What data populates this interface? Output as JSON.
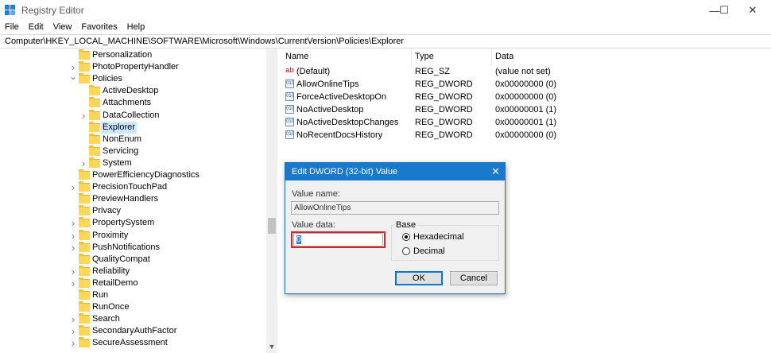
{
  "window": {
    "title": "Registry Editor"
  },
  "menu": [
    "File",
    "Edit",
    "View",
    "Favorites",
    "Help"
  ],
  "address": "Computer\\HKEY_LOCAL_MACHINE\\SOFTWARE\\Microsoft\\Windows\\CurrentVersion\\Policies\\Explorer",
  "tree": [
    {
      "label": "Personalization",
      "level": 0,
      "chevron": ""
    },
    {
      "label": "PhotoPropertyHandler",
      "level": 0,
      "chevron": ">"
    },
    {
      "label": "Policies",
      "level": 0,
      "chevron": "v"
    },
    {
      "label": "ActiveDesktop",
      "level": 1,
      "chevron": ""
    },
    {
      "label": "Attachments",
      "level": 1,
      "chevron": ""
    },
    {
      "label": "DataCollection",
      "level": 1,
      "chevron": ">"
    },
    {
      "label": "Explorer",
      "level": 1,
      "chevron": "",
      "selected": true
    },
    {
      "label": "NonEnum",
      "level": 1,
      "chevron": ""
    },
    {
      "label": "Servicing",
      "level": 1,
      "chevron": ""
    },
    {
      "label": "System",
      "level": 1,
      "chevron": ">"
    },
    {
      "label": "PowerEfficiencyDiagnostics",
      "level": 0,
      "chevron": ""
    },
    {
      "label": "PrecisionTouchPad",
      "level": 0,
      "chevron": ">"
    },
    {
      "label": "PreviewHandlers",
      "level": 0,
      "chevron": ""
    },
    {
      "label": "Privacy",
      "level": 0,
      "chevron": ""
    },
    {
      "label": "PropertySystem",
      "level": 0,
      "chevron": ">"
    },
    {
      "label": "Proximity",
      "level": 0,
      "chevron": ">"
    },
    {
      "label": "PushNotifications",
      "level": 0,
      "chevron": ">"
    },
    {
      "label": "QualityCompat",
      "level": 0,
      "chevron": ""
    },
    {
      "label": "Reliability",
      "level": 0,
      "chevron": ">"
    },
    {
      "label": "RetailDemo",
      "level": 0,
      "chevron": ">"
    },
    {
      "label": "Run",
      "level": 0,
      "chevron": ""
    },
    {
      "label": "RunOnce",
      "level": 0,
      "chevron": ""
    },
    {
      "label": "Search",
      "level": 0,
      "chevron": ">"
    },
    {
      "label": "SecondaryAuthFactor",
      "level": 0,
      "chevron": ">"
    },
    {
      "label": "SecureAssessment",
      "level": 0,
      "chevron": ">"
    }
  ],
  "columns": {
    "name": "Name",
    "type": "Type",
    "data": "Data"
  },
  "values": [
    {
      "icon": "ab",
      "name": "(Default)",
      "type": "REG_SZ",
      "data": "(value not set)"
    },
    {
      "icon": "bin",
      "name": "AllowOnlineTips",
      "type": "REG_DWORD",
      "data": "0x00000000 (0)"
    },
    {
      "icon": "bin",
      "name": "ForceActiveDesktopOn",
      "type": "REG_DWORD",
      "data": "0x00000000 (0)"
    },
    {
      "icon": "bin",
      "name": "NoActiveDesktop",
      "type": "REG_DWORD",
      "data": "0x00000001 (1)"
    },
    {
      "icon": "bin",
      "name": "NoActiveDesktopChanges",
      "type": "REG_DWORD",
      "data": "0x00000001 (1)"
    },
    {
      "icon": "bin",
      "name": "NoRecentDocsHistory",
      "type": "REG_DWORD",
      "data": "0x00000000 (0)"
    }
  ],
  "dialog": {
    "title": "Edit DWORD (32-bit) Value",
    "value_name_label": "Value name:",
    "value_name": "AllowOnlineTips",
    "value_data_label": "Value data:",
    "value_data": "0",
    "base_label": "Base",
    "radio_hex": "Hexadecimal",
    "radio_dec": "Decimal",
    "ok": "OK",
    "cancel": "Cancel"
  }
}
